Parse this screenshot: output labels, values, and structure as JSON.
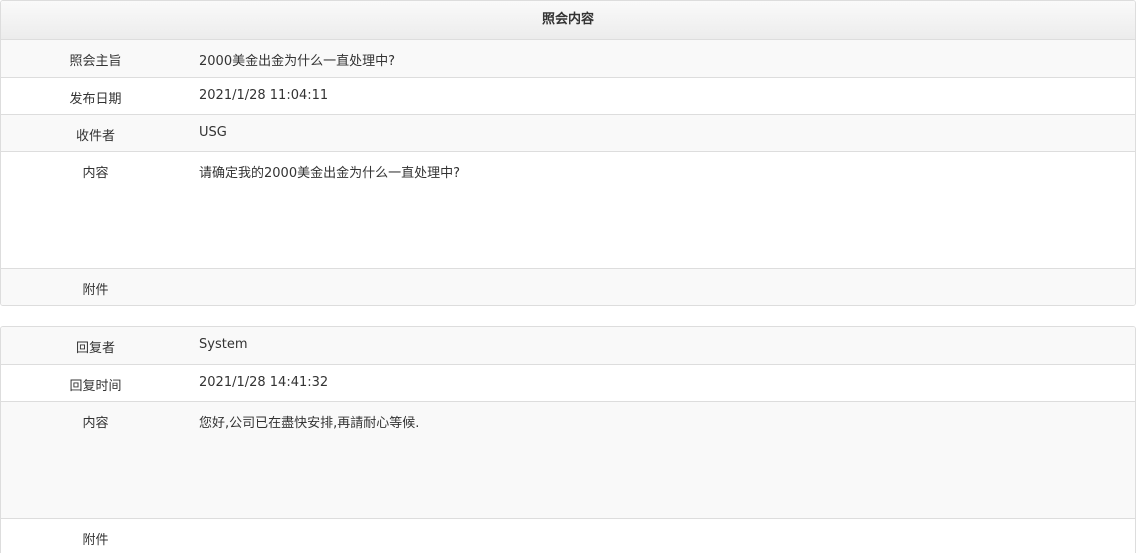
{
  "inquiry": {
    "header": "照会内容",
    "rows": [
      {
        "label": "照会主旨",
        "value": "2000美金出金为什么一直处理中?"
      },
      {
        "label": "发布日期",
        "value": "2021/1/28 11:04:11"
      },
      {
        "label": "收件者",
        "value": "USG"
      },
      {
        "label": "内容",
        "value": "请确定我的2000美金出金为什么一直处理中?"
      },
      {
        "label": "附件",
        "value": ""
      }
    ]
  },
  "reply": {
    "rows": [
      {
        "label": "回复者",
        "value": "System"
      },
      {
        "label": "回复时间",
        "value": "2021/1/28 14:41:32"
      },
      {
        "label": "内容",
        "value": "您好,公司已在盡快安排,再請耐心等候."
      },
      {
        "label": "附件",
        "value": ""
      }
    ]
  }
}
